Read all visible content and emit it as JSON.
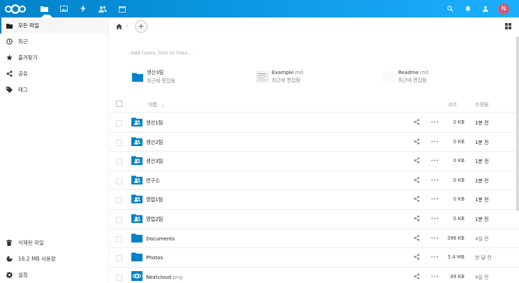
{
  "header": {
    "app_icons": [
      "files-icon",
      "photos-icon",
      "activity-icon",
      "contacts-icon",
      "calendar-icon"
    ],
    "avatar_initial": "N",
    "accent": "#0082c9"
  },
  "sidebar": {
    "items": [
      {
        "label": "모든 파일",
        "icon": "folder-icon",
        "active": true
      },
      {
        "label": "최근",
        "icon": "clock-icon"
      },
      {
        "label": "즐겨찾기",
        "icon": "star-icon"
      },
      {
        "label": "공유",
        "icon": "share-icon"
      },
      {
        "label": "태그",
        "icon": "tag-icon"
      }
    ],
    "bottom": {
      "deleted": "삭제된 파일",
      "quota": "16.2 MB 사용함",
      "settings": "설정"
    }
  },
  "main": {
    "notes_placeholder": "Add notes, lists or links …",
    "recent": [
      {
        "name": "생산3팀",
        "ext": "",
        "sub": "최근에 편집됨",
        "type": "folder"
      },
      {
        "name": "Example",
        "ext": ".md",
        "sub": "최근에 편집됨",
        "type": "doc"
      },
      {
        "name": "Readme",
        "ext": ".md",
        "sub": "최근에 편집됨",
        "type": "blank"
      }
    ],
    "columns": {
      "name": "이름",
      "size": "크기",
      "modified": "수정됨"
    },
    "files": [
      {
        "name": "생산1팀",
        "ext": "",
        "size": "0 KB",
        "modified": "1분 전",
        "type": "shared"
      },
      {
        "name": "생산2팀",
        "ext": "",
        "size": "0 KB",
        "modified": "1분 전",
        "type": "shared"
      },
      {
        "name": "생산3팀",
        "ext": "",
        "size": "0 KB",
        "modified": "1분 전",
        "type": "shared"
      },
      {
        "name": "연구소",
        "ext": "",
        "size": "0 KB",
        "modified": "1분 전",
        "type": "shared"
      },
      {
        "name": "영업1팀",
        "ext": "",
        "size": "0 KB",
        "modified": "1분 전",
        "type": "shared"
      },
      {
        "name": "영업2팀",
        "ext": "",
        "size": "0 KB",
        "modified": "1분 전",
        "type": "shared"
      },
      {
        "name": "Documents",
        "ext": "",
        "size": "396 KB",
        "modified": "4일 전",
        "type": "folder"
      },
      {
        "name": "Photos",
        "ext": "",
        "size": "5.4 MB",
        "modified": "한 달 전",
        "type": "folder"
      },
      {
        "name": "Nextcloud",
        "ext": ".png",
        "size": "49 KB",
        "modified": "4일 전",
        "type": "image"
      }
    ]
  }
}
